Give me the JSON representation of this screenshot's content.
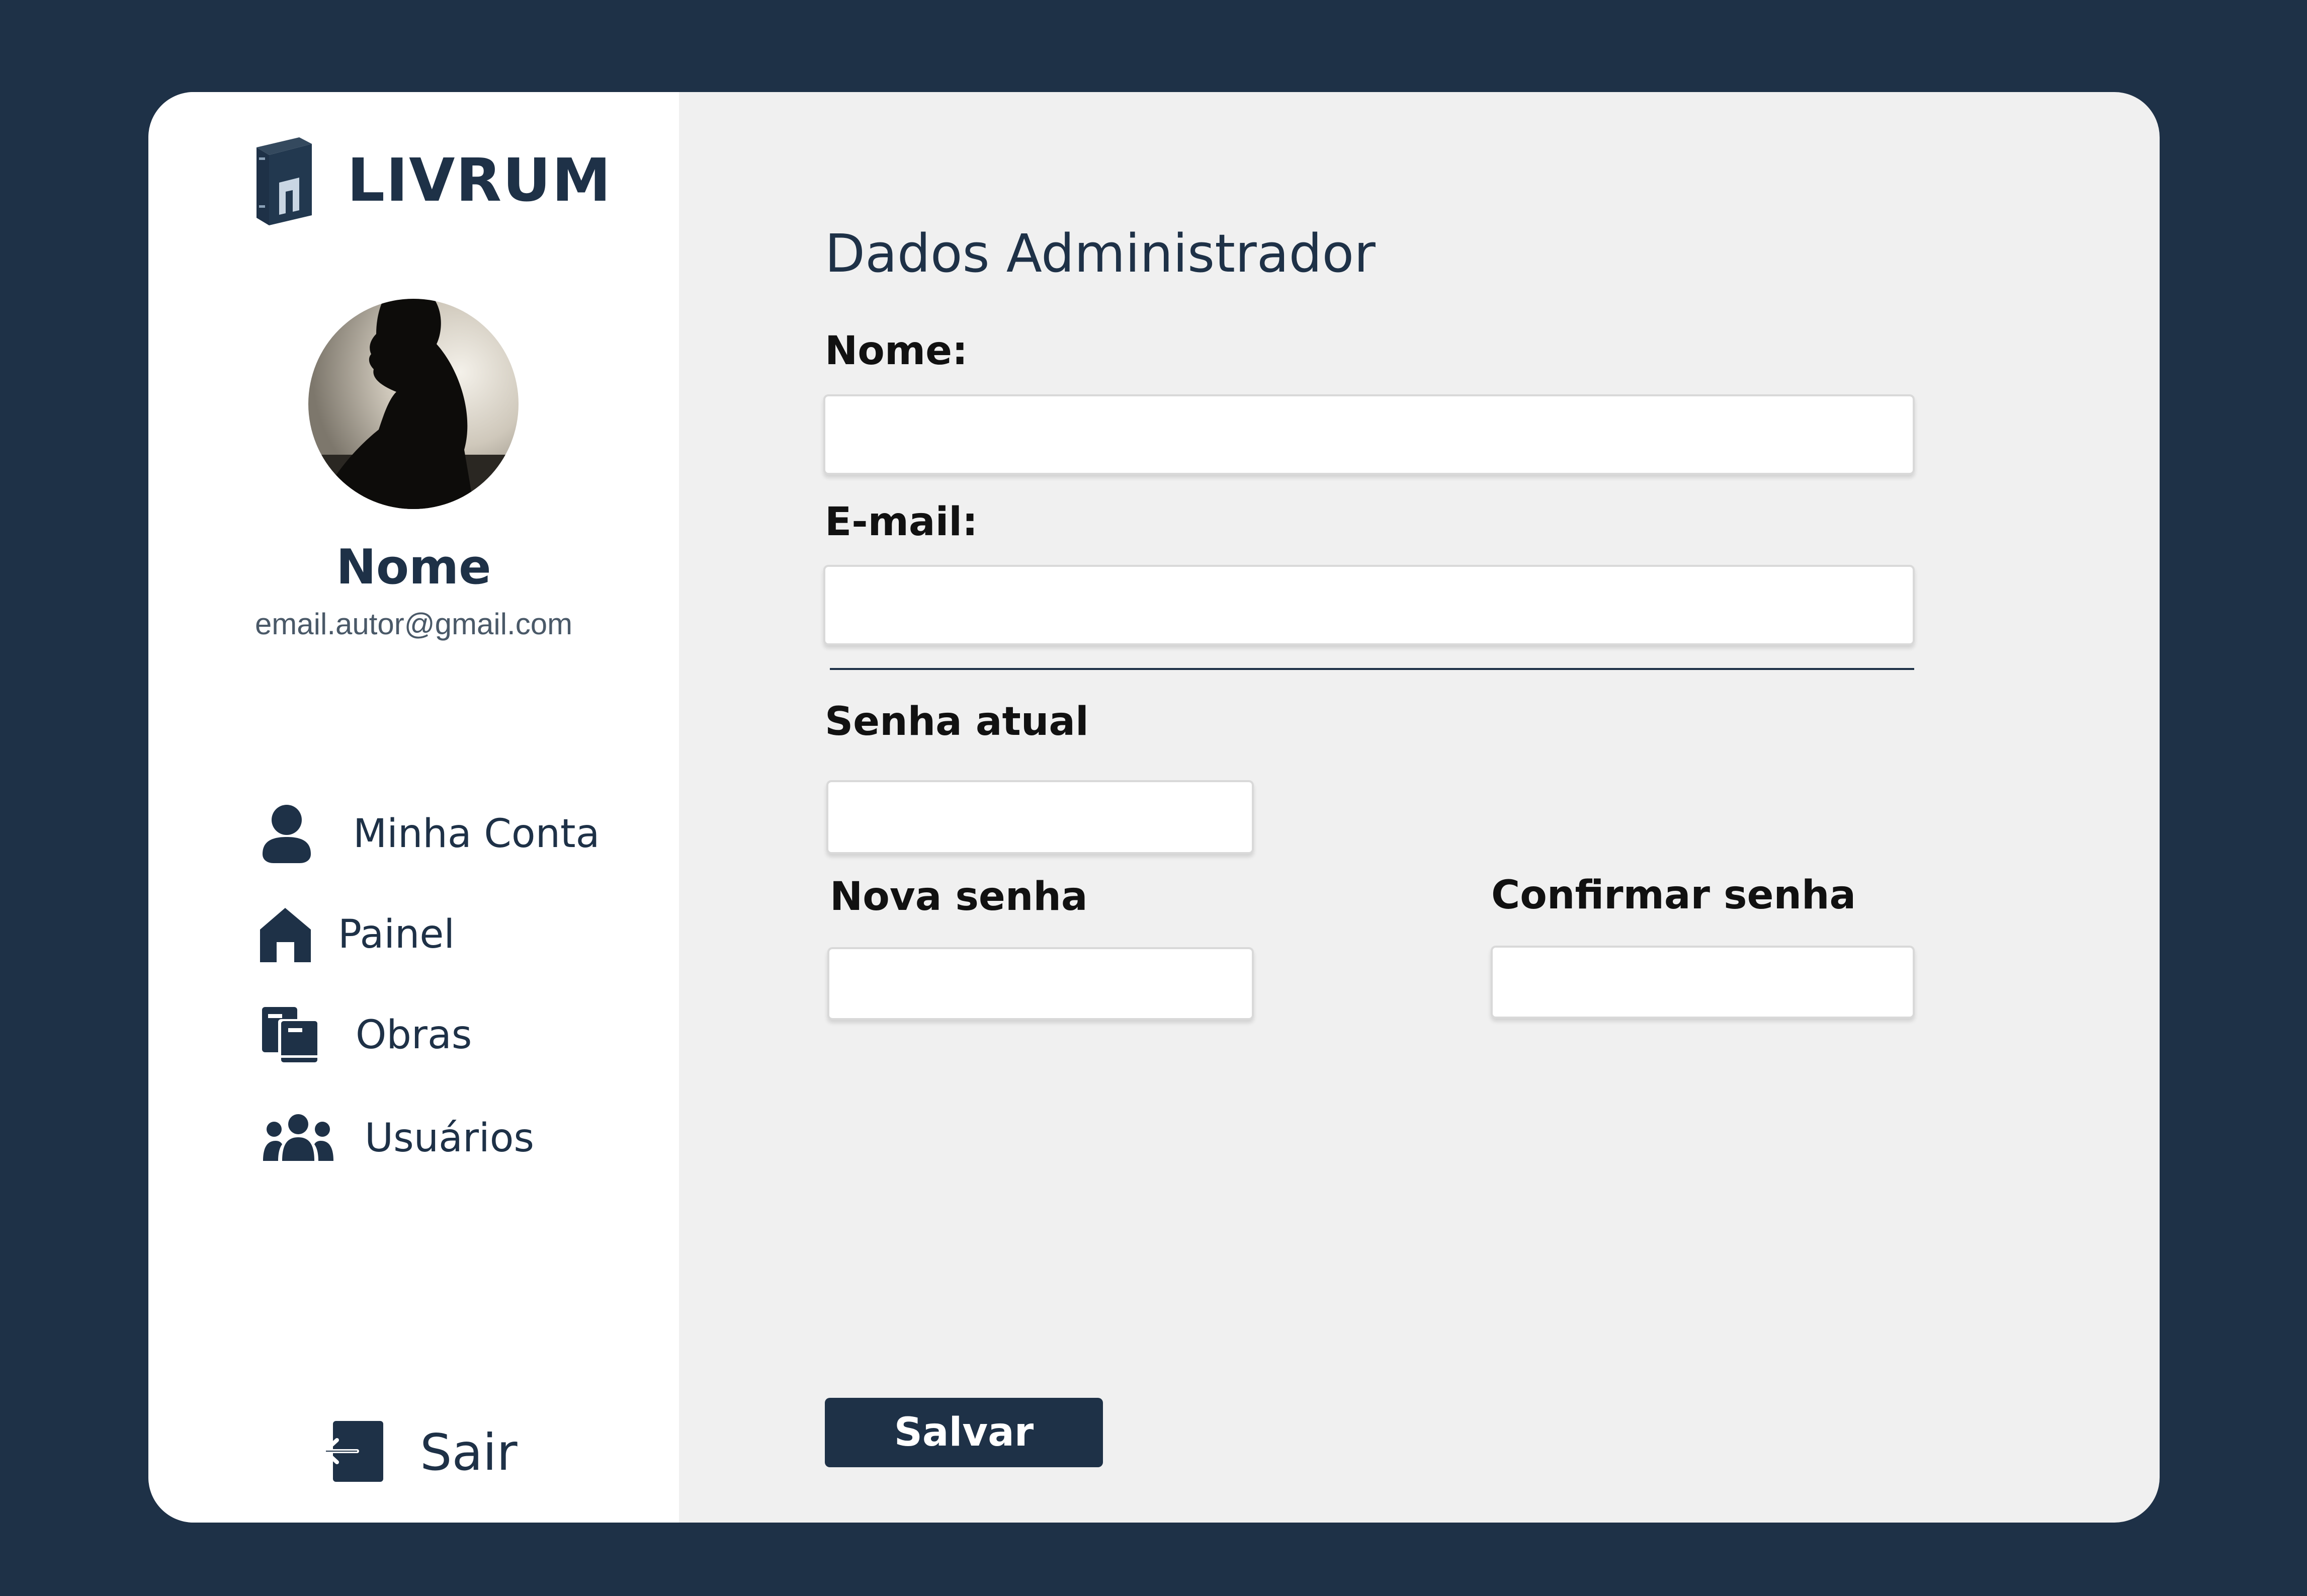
{
  "brand": {
    "name": "LIVRUM",
    "icon": "book-logo-icon"
  },
  "profile": {
    "name": "Nome",
    "email": "email.autor@gmail.com",
    "avatar": "silhouette-portrait"
  },
  "sidebar": {
    "items": [
      {
        "label": "Minha Conta",
        "icon": "user-icon"
      },
      {
        "label": "Painel",
        "icon": "home-icon"
      },
      {
        "label": "Obras",
        "icon": "books-icon"
      },
      {
        "label": "Usuários",
        "icon": "users-icon"
      }
    ],
    "logout": {
      "label": "Sair",
      "icon": "logout-icon"
    }
  },
  "main": {
    "title": "Dados Administrador",
    "fields": {
      "name": {
        "label": "Nome:",
        "value": ""
      },
      "email": {
        "label": "E-mail:",
        "value": ""
      },
      "current_password": {
        "label": "Senha atual",
        "value": ""
      },
      "new_password": {
        "label": "Nova senha",
        "value": ""
      },
      "confirm_password": {
        "label": "Confirmar senha",
        "value": ""
      }
    },
    "save_label": "Salvar"
  },
  "colors": {
    "background": "#1e3147",
    "primary": "#1e3147",
    "content_bg": "#f0f0f0",
    "sidebar_bg": "#ffffff"
  }
}
